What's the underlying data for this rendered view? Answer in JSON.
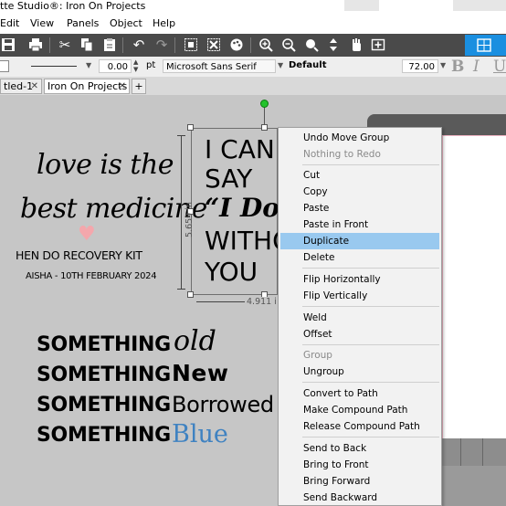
{
  "window": {
    "title": "tte Studio®: Iron On Projects"
  },
  "menu": {
    "items": [
      "Edit",
      "View",
      "Panels",
      "Object",
      "Help"
    ]
  },
  "properties": {
    "line_width": "0.00",
    "line_unit": "pt",
    "font": "Microsoft Sans Serif",
    "style": "Default",
    "font_size": "72.00",
    "bold_glyph": "B",
    "italic_glyph": "I",
    "underline_glyph": "U"
  },
  "tabs": [
    {
      "label": "tled-1"
    },
    {
      "label": "Iron On Projects"
    }
  ],
  "tab_add": "+",
  "design": {
    "line1": "love is the",
    "line2": "best medicine",
    "heart": "♥",
    "subtitle": "HEN DO RECOVERY KIT",
    "date_line": "AISHA - 10TH FEBRUARY 2024",
    "phrase": [
      "I CAN",
      "SAY",
      "“I Do",
      "WITHO",
      "YOU"
    ],
    "height_dim": "5.659 in",
    "width_dim": "4.911 i",
    "something_word": "SOMETHING",
    "something_items": [
      {
        "word": "old"
      },
      {
        "word": "New"
      },
      {
        "word": "Borrowed"
      },
      {
        "word": "Blue"
      }
    ]
  },
  "colors": {
    "heart": "#f4a7ac",
    "blue_word": "#3f82c1",
    "highlight": "#99c9ef",
    "toolbar": "#4a4a4a",
    "accent": "#1a8fe0",
    "handle_green": "#22c32b"
  },
  "context_menu": {
    "items": [
      {
        "label": "Undo Move Group",
        "disabled": false
      },
      {
        "label": "Nothing to Redo",
        "disabled": true
      },
      {
        "label": "Cut",
        "disabled": false
      },
      {
        "label": "Copy",
        "disabled": false
      },
      {
        "label": "Paste",
        "disabled": false
      },
      {
        "label": "Paste in Front",
        "disabled": false
      },
      {
        "label": "Duplicate",
        "disabled": false,
        "highlighted": true
      },
      {
        "label": "Delete",
        "disabled": false
      },
      {
        "label": "Flip Horizontally",
        "disabled": false
      },
      {
        "label": "Flip Vertically",
        "disabled": false
      },
      {
        "label": "Weld",
        "disabled": false
      },
      {
        "label": "Offset",
        "disabled": false
      },
      {
        "label": "Group",
        "disabled": true
      },
      {
        "label": "Ungroup",
        "disabled": false
      },
      {
        "label": "Convert to Path",
        "disabled": false
      },
      {
        "label": "Make Compound Path",
        "disabled": false
      },
      {
        "label": "Release Compound Path",
        "disabled": false
      },
      {
        "label": "Send to Back",
        "disabled": false
      },
      {
        "label": "Bring to Front",
        "disabled": false
      },
      {
        "label": "Bring Forward",
        "disabled": false
      },
      {
        "label": "Send Backward",
        "disabled": false
      }
    ]
  }
}
